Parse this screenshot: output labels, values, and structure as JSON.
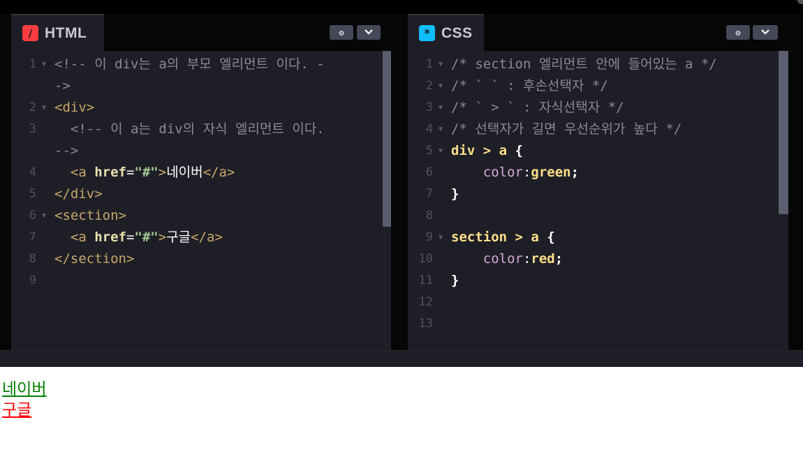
{
  "html_panel": {
    "title": "HTML",
    "logo_icon": "html-logo-icon",
    "logo_glyph": "/",
    "logo_color": "#ff3c41",
    "lines": [
      {
        "num": "1",
        "fold": true,
        "segments": [
          {
            "t": "<!-- 이 div는 a의 부모 엘리먼트 이다. -",
            "c": "comment"
          }
        ]
      },
      {
        "num": "",
        "fold": false,
        "segments": [
          {
            "t": "->",
            "c": "comment"
          }
        ]
      },
      {
        "num": "2",
        "fold": true,
        "segments": [
          {
            "t": "<div>",
            "c": "tag"
          }
        ]
      },
      {
        "num": "3",
        "fold": false,
        "segments": [
          {
            "t": "  <!-- 이 a는 div의 자식 엘리먼트 이다.",
            "c": "comment"
          }
        ]
      },
      {
        "num": "",
        "fold": false,
        "segments": [
          {
            "t": "-->",
            "c": "comment"
          }
        ]
      },
      {
        "num": "4",
        "fold": false,
        "segments": [
          {
            "t": "  <a ",
            "c": "tag"
          },
          {
            "t": "href",
            "c": "attr"
          },
          {
            "t": "=",
            "c": "text"
          },
          {
            "t": "\"#\"",
            "c": "str"
          },
          {
            "t": ">",
            "c": "tag"
          },
          {
            "t": "네이버",
            "c": "text"
          },
          {
            "t": "</a>",
            "c": "tag"
          }
        ]
      },
      {
        "num": "5",
        "fold": false,
        "segments": [
          {
            "t": "</div>",
            "c": "tag"
          }
        ]
      },
      {
        "num": "6",
        "fold": true,
        "segments": [
          {
            "t": "<section>",
            "c": "tag"
          }
        ]
      },
      {
        "num": "7",
        "fold": false,
        "segments": [
          {
            "t": "  <a ",
            "c": "tag"
          },
          {
            "t": "href",
            "c": "attr"
          },
          {
            "t": "=",
            "c": "text"
          },
          {
            "t": "\"#\"",
            "c": "str"
          },
          {
            "t": ">",
            "c": "tag"
          },
          {
            "t": "구글",
            "c": "text"
          },
          {
            "t": "</a>",
            "c": "tag"
          }
        ]
      },
      {
        "num": "8",
        "fold": false,
        "segments": [
          {
            "t": "</section>",
            "c": "tag"
          }
        ]
      },
      {
        "num": "9",
        "fold": false,
        "segments": []
      }
    ]
  },
  "css_panel": {
    "title": "CSS",
    "logo_icon": "css-logo-icon",
    "logo_glyph": "*",
    "logo_color": "#0ebeff",
    "lines": [
      {
        "num": "1",
        "fold": true,
        "segments": [
          {
            "t": "/* section 엘리먼트 안에 들어있는 a */",
            "c": "comment"
          }
        ]
      },
      {
        "num": "2",
        "fold": true,
        "segments": [
          {
            "t": "/* ` ` : 후손선택자 */",
            "c": "comment"
          }
        ]
      },
      {
        "num": "3",
        "fold": true,
        "segments": [
          {
            "t": "/* ` > ` : 자식선택자 */",
            "c": "comment"
          }
        ]
      },
      {
        "num": "4",
        "fold": true,
        "segments": [
          {
            "t": "/* 선택자가 길면 우선순위가 높다 */",
            "c": "comment"
          }
        ]
      },
      {
        "num": "5",
        "fold": true,
        "segments": [
          {
            "t": "div > a ",
            "c": "sel"
          },
          {
            "t": "{",
            "c": "punct"
          }
        ]
      },
      {
        "num": "6",
        "fold": false,
        "segments": [
          {
            "t": "    color",
            "c": "prop"
          },
          {
            "t": ":",
            "c": "text"
          },
          {
            "t": "green",
            "c": "val"
          },
          {
            "t": ";",
            "c": "punct"
          }
        ]
      },
      {
        "num": "7",
        "fold": false,
        "segments": [
          {
            "t": "}",
            "c": "punct"
          }
        ]
      },
      {
        "num": "8",
        "fold": false,
        "segments": []
      },
      {
        "num": "9",
        "fold": true,
        "segments": [
          {
            "t": "section > a ",
            "c": "sel"
          },
          {
            "t": "{",
            "c": "punct"
          }
        ]
      },
      {
        "num": "10",
        "fold": false,
        "segments": [
          {
            "t": "    color",
            "c": "prop"
          },
          {
            "t": ":",
            "c": "text"
          },
          {
            "t": "red",
            "c": "val"
          },
          {
            "t": ";",
            "c": "punct"
          }
        ]
      },
      {
        "num": "11",
        "fold": false,
        "segments": [
          {
            "t": "}",
            "c": "punct"
          }
        ]
      },
      {
        "num": "12",
        "fold": false,
        "segments": []
      },
      {
        "num": "13",
        "fold": false,
        "segments": []
      }
    ]
  },
  "header_buttons": {
    "settings_icon": "gear-icon",
    "settings_glyph": "⚙",
    "collapse_icon": "chevron-down-icon",
    "collapse_glyph": "⌄"
  },
  "preview": {
    "link1": {
      "text": "네이버",
      "color": "#008000"
    },
    "link2": {
      "text": "구글",
      "color": "#ff0000"
    }
  }
}
